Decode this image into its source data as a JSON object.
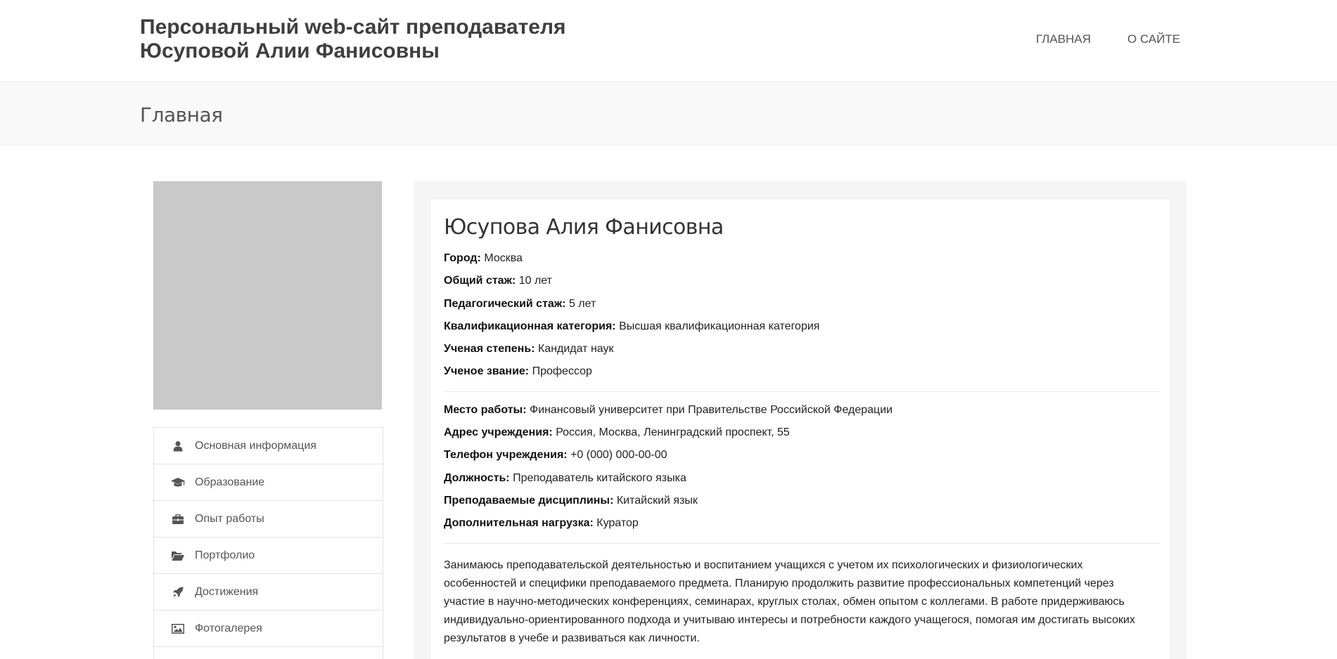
{
  "header": {
    "title_line1": "Персональный web-сайт преподавателя",
    "title_line2": "Юсуповой Алии Фанисовны",
    "nav": [
      {
        "label": "ГЛАВНАЯ"
      },
      {
        "label": "О САЙТЕ"
      }
    ]
  },
  "page": {
    "heading": "Главная"
  },
  "sidebar": {
    "items": [
      {
        "label": "Основная информация",
        "icon": "user-icon"
      },
      {
        "label": "Образование",
        "icon": "graduation-cap-icon"
      },
      {
        "label": "Опыт работы",
        "icon": "briefcase-icon"
      },
      {
        "label": "Портфолио",
        "icon": "folder-open-icon"
      },
      {
        "label": "Достижения",
        "icon": "rocket-icon"
      },
      {
        "label": "Фотогалерея",
        "icon": "image-icon"
      }
    ]
  },
  "profile": {
    "name": "Юсупова Алия Фанисовна",
    "fields": [
      {
        "label": "Город:",
        "value": "Москва"
      },
      {
        "label": "Общий стаж:",
        "value": "10 лет"
      },
      {
        "label": "Педагогический стаж:",
        "value": "5 лет"
      },
      {
        "label": "Квалификационная категория:",
        "value": "Высшая квалификационная категория"
      },
      {
        "label": "Ученая степень:",
        "value": "Кандидат наук"
      },
      {
        "label": "Ученое звание:",
        "value": "Профессор"
      }
    ],
    "work": [
      {
        "label": "Место работы:",
        "value": "Финансовый университет при Правительстве Российской Федерации"
      },
      {
        "label": "Адрес учреждения:",
        "value": "Россия, Москва, Ленинградский проспект, 55"
      },
      {
        "label": "Телефон учреждения:",
        "value": "+0 (000) 000-00-00"
      },
      {
        "label": "Должность:",
        "value": "Преподаватель китайского языка"
      },
      {
        "label": "Преподаваемые дисциплины:",
        "value": "Китайский язык"
      },
      {
        "label": "Дополнительная нагрузка:",
        "value": "Куратор"
      }
    ],
    "bio": "Занимаюсь преподавательской деятельностью и воспитанием учащихся с учетом их психологических и физиологических особенностей и специфики преподаваемого предмета. Планирую продолжить развитие профессиональных компетенций через участие в научно-методических конференциях, семинарах, круглых столах, обмен опытом с коллегами. В работе придерживаюсь индивидуально-ориентированного подхода и учитываю интересы и потребности каждого учащегося, помогая им достигать высоких результатов в учебе и развиваться как личности."
  },
  "colors": {
    "photo_placeholder": "#c9c9c9",
    "page_bar": "#f9f9f9",
    "card_outer": "#f5f5f5",
    "icon": "#555555"
  }
}
